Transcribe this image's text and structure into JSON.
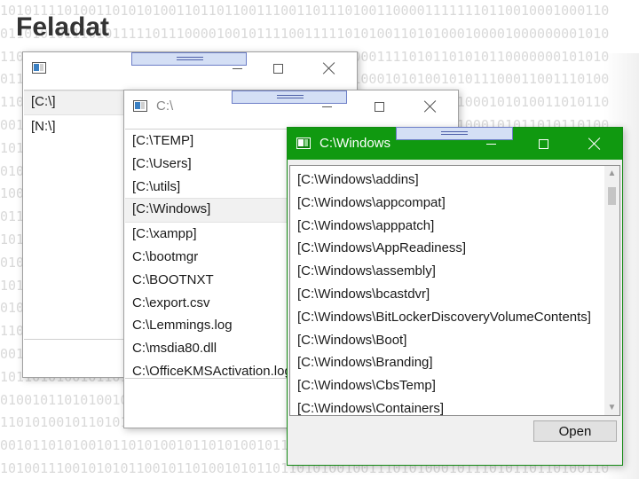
{
  "slide": {
    "title": "Feladat"
  },
  "background_binary": [
    "1010111101001101010100110110110011100110111010011000011111110110010001000110",
    "0110101011101011111011100001001011110011111010100110101000100001000000001010",
    "1101010001011101001001001010001000111101011000011110101101010110000000101010",
    "0110110110101011001100110111010001101011011110001010100101011100011001110100",
    "1101010110100110100010110001111010011001010110011000111001000101010011010110",
    "0010101101010010110110000101001101001100011101010101101011000101011010110100",
    "1010110100100101001010101001110100101011101101000101011010011101000101001010",
    "0101001011011010100101101010100101101001010110101011010100110101011010010101",
    "1001010110100101101010010101101001011010101101010010110101011010010101101010",
    "0110101001011010010101101010010110101001011010100101011010100101101010010110",
    "1010010110101001011010100101101010010110101001011010100101101010010110101001",
    "0101101010010110101001011010100101101010010110101001011010100101101010010110",
    "1010100101101010010110101001011010100101101010010110101001011010100101101010",
    "0101011010100101101010010110101001011010100101101010010110101001011010100101",
    "1101001011010100101101010010110101001011010100101101010010110101001011010100",
    "0010110101001011010100101101010010110101001011010100101101010010110101001011",
    "1011010100101101010010110101001011010100101101010010110101001011010100101101",
    "0100101101010010110101001011010100101101010010110101001011010100101101010010",
    "1101010010110101001011010100101101010010110101001011010100101101010010110101",
    "0010110101001011010100101101010010110101001011010100101101010010110101001011",
    "1010011100101010110010110100101011011010100100111010100010111010110110100110"
  ],
  "window1": {
    "title": "",
    "items": [
      "[C:\\]",
      "[N:\\]"
    ],
    "selected_index": 0
  },
  "window2": {
    "title": "C:\\",
    "items": [
      "[C:\\TEMP]",
      "[C:\\Users]",
      "[C:\\utils]",
      "[C:\\Windows]",
      "[C:\\xampp]",
      "C:\\bootmgr",
      "C:\\BOOTNXT",
      "C:\\export.csv",
      "C:\\Lemmings.log",
      "C:\\msdia80.dll",
      "C:\\OfficeKMSActivation.log"
    ],
    "selected_index": 3
  },
  "window3": {
    "title": "C:\\Windows",
    "items": [
      "[C:\\Windows\\addins]",
      "[C:\\Windows\\appcompat]",
      "[C:\\Windows\\apppatch]",
      "[C:\\Windows\\AppReadiness]",
      "[C:\\Windows\\assembly]",
      "[C:\\Windows\\bcastdvr]",
      "[C:\\Windows\\BitLockerDiscoveryVolumeContents]",
      "[C:\\Windows\\Boot]",
      "[C:\\Windows\\Branding]",
      "[C:\\Windows\\CbsTemp]",
      "[C:\\Windows\\Containers]"
    ],
    "open_button": "Open"
  },
  "colors": {
    "titlebar_active": "#109910",
    "tag_fill": "#d4dff5",
    "tag_border": "#6c7ec7"
  }
}
